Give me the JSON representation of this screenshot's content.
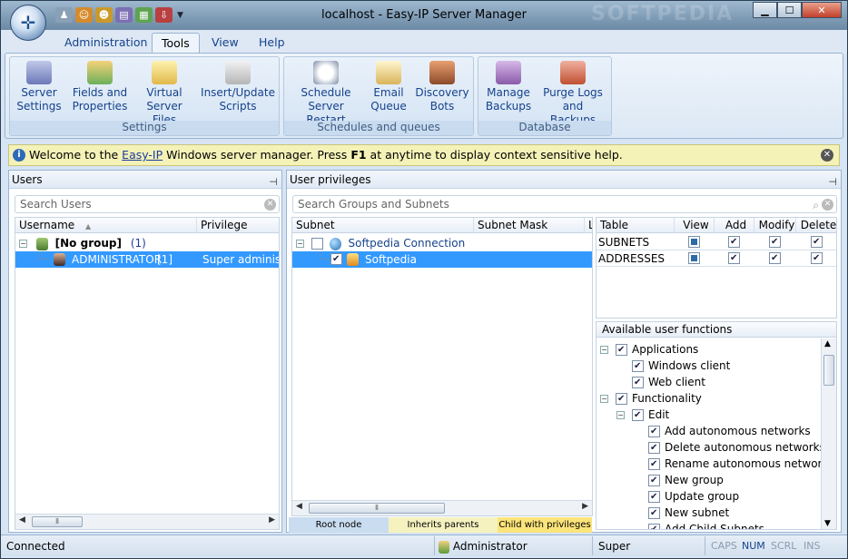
{
  "window": {
    "title": "localhost - Easy-IP Server Manager",
    "watermark": "SOFTPEDIA"
  },
  "qat_icons": [
    "users-icon",
    "user-add-icon",
    "user-lock-icon",
    "document-icon",
    "grid-icon",
    "export-icon"
  ],
  "tabs": [
    "Administration",
    "Tools",
    "View",
    "Help"
  ],
  "active_tab": "Tools",
  "ribbon": {
    "groups": [
      {
        "label": "Settings",
        "buttons": [
          {
            "l1": "Server",
            "l2": "Settings"
          },
          {
            "l1": "Fields and",
            "l2": "Properties"
          },
          {
            "l1": "Virtual",
            "l2": "Server Files"
          },
          {
            "l1": "Insert/Update",
            "l2": "Scripts"
          }
        ]
      },
      {
        "label": "Schedules and queues",
        "buttons": [
          {
            "l1": "Schedule",
            "l2": "Server Restart"
          },
          {
            "l1": "Email",
            "l2": "Queue"
          },
          {
            "l1": "Discovery",
            "l2": "Bots"
          }
        ]
      },
      {
        "label": "Database",
        "buttons": [
          {
            "l1": "Manage",
            "l2": "Backups"
          },
          {
            "l1": "Purge Logs",
            "l2": "and Backups"
          }
        ]
      }
    ]
  },
  "infobar": {
    "pre": "Welcome to the ",
    "link": "Easy-IP",
    "mid": " Windows server manager. Press ",
    "key": "F1",
    "post": " at anytime to display context sensitive help."
  },
  "users_panel": {
    "title": "Users",
    "search_placeholder": "Search Users",
    "col_username": "Username",
    "col_privilege": "Privilege",
    "group_name": "[No group]",
    "group_count": "(1)",
    "user_name": "ADMINISTRATOR",
    "user_count": "[1]",
    "user_privilege": "Super administrat"
  },
  "privileges_panel": {
    "title": "User privileges",
    "search_placeholder": "Search Groups and Subnets",
    "col_subnet": "Subnet",
    "col_mask": "Subnet Mask",
    "col_extra": "L",
    "root": "Softpedia Connection",
    "child": "Softpedia",
    "legend": [
      "Root node",
      "Inherits parents privileges",
      "Child with privileges"
    ]
  },
  "table_perms": {
    "headers": [
      "Table",
      "View",
      "Add",
      "Modify",
      "Delete"
    ],
    "rows": [
      {
        "name": "SUBNETS"
      },
      {
        "name": "ADDRESSES"
      }
    ]
  },
  "functions": {
    "title": "Available user functions",
    "items": [
      {
        "label": "Applications",
        "level": 0,
        "expander": "−"
      },
      {
        "label": "Windows client",
        "level": 1
      },
      {
        "label": "Web client",
        "level": 1
      },
      {
        "label": "Functionality",
        "level": 0,
        "expander": "−"
      },
      {
        "label": "Edit",
        "level": 1,
        "expander": "−"
      },
      {
        "label": "Add autonomous networks",
        "level": 2
      },
      {
        "label": "Delete autonomous networks",
        "level": 2
      },
      {
        "label": "Rename autonomous networks",
        "level": 2
      },
      {
        "label": "New group",
        "level": 2
      },
      {
        "label": "Update group",
        "level": 2
      },
      {
        "label": "New subnet",
        "level": 2
      },
      {
        "label": "Add Child Subnets",
        "level": 2
      }
    ]
  },
  "status": {
    "state": "Connected",
    "user": "Administrator",
    "role": "Super administrator",
    "caps": "CAPS",
    "num": "NUM",
    "scrl": "SCRL",
    "ins": "INS"
  },
  "colors": {
    "accent": "#15428b",
    "selection": "#3399ff",
    "info_bg": "#f5f2b8"
  }
}
